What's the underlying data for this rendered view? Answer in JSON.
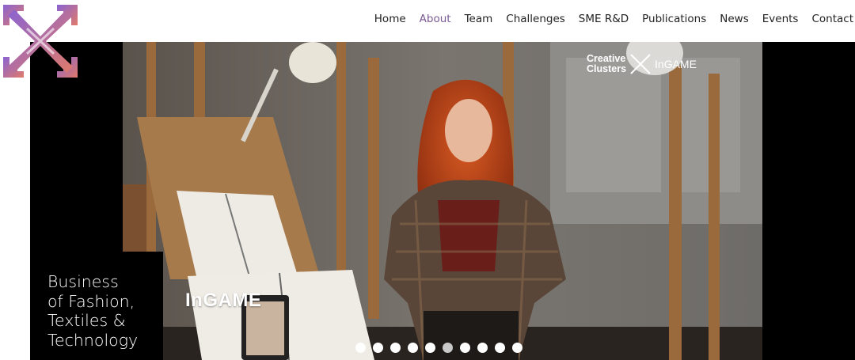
{
  "nav": {
    "items": [
      {
        "label": "Home",
        "active": false
      },
      {
        "label": "About",
        "active": true
      },
      {
        "label": "Team",
        "active": false
      },
      {
        "label": "Challenges",
        "active": false
      },
      {
        "label": "SME R&D",
        "active": false
      },
      {
        "label": "Publications",
        "active": false
      },
      {
        "label": "News",
        "active": false
      },
      {
        "label": "Events",
        "active": false
      },
      {
        "label": "Contact",
        "active": false
      }
    ]
  },
  "hero": {
    "caption": "Business\nof Fashion,\nTextiles &\nTechnology",
    "overlay_text": "InGAME",
    "partner_logo": {
      "line1": "Creative",
      "line2": "Clusters",
      "brand": "InGAME"
    },
    "carousel": {
      "slide_count": 10,
      "active_index": 5
    }
  },
  "colors": {
    "accent": "#7b5a92",
    "logo_gradient_start": "#8a63d2",
    "logo_gradient_end": "#e07a6a"
  }
}
